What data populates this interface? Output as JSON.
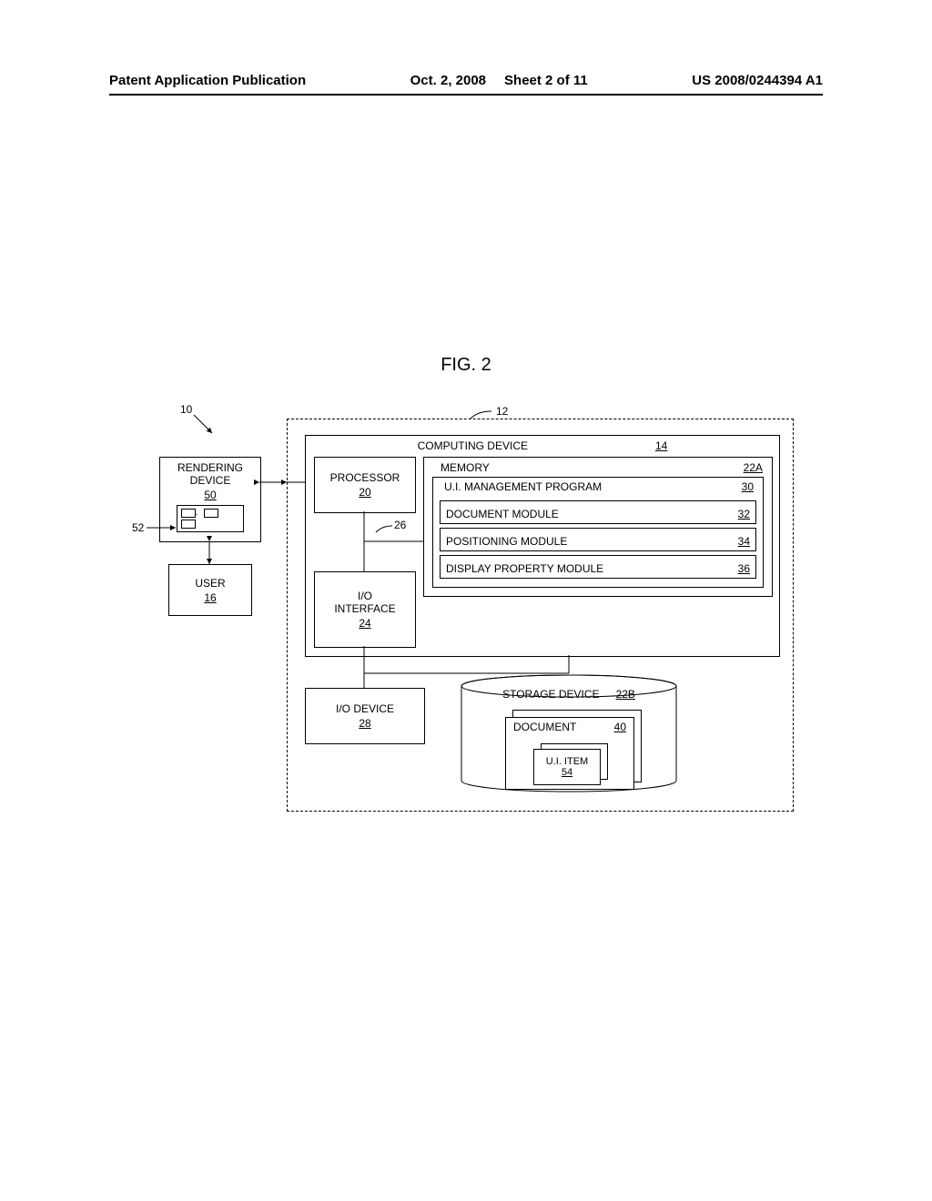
{
  "header": {
    "left": "Patent Application Publication",
    "date": "Oct. 2, 2008",
    "sheet": "Sheet 2 of 11",
    "pubno": "US 2008/0244394 A1"
  },
  "figure_caption": "FIG. 2",
  "refs": {
    "r10": "10",
    "r12": "12",
    "r14": "14",
    "r16": "16",
    "r20": "20",
    "r22A": "22A",
    "r22B": "22B",
    "r24": "24",
    "r26": "26",
    "r28": "28",
    "r30": "30",
    "r32": "32",
    "r34": "34",
    "r36": "36",
    "r40": "40",
    "r50": "50",
    "r52": "52",
    "r54": "54"
  },
  "labels": {
    "computing_device": "COMPUTING DEVICE",
    "processor": "PROCESSOR",
    "memory": "MEMORY",
    "ui_mgmt": "U.I. MANAGEMENT PROGRAM",
    "doc_module": "DOCUMENT MODULE",
    "pos_module": "POSITIONING MODULE",
    "disp_module": "DISPLAY PROPERTY MODULE",
    "io_interface": "I/O\nINTERFACE",
    "io_device": "I/O DEVICE",
    "storage_device": "STORAGE DEVICE",
    "document": "DOCUMENT",
    "ui_item": "U.I. ITEM",
    "rendering_device": "RENDERING\nDEVICE",
    "user": "USER"
  }
}
